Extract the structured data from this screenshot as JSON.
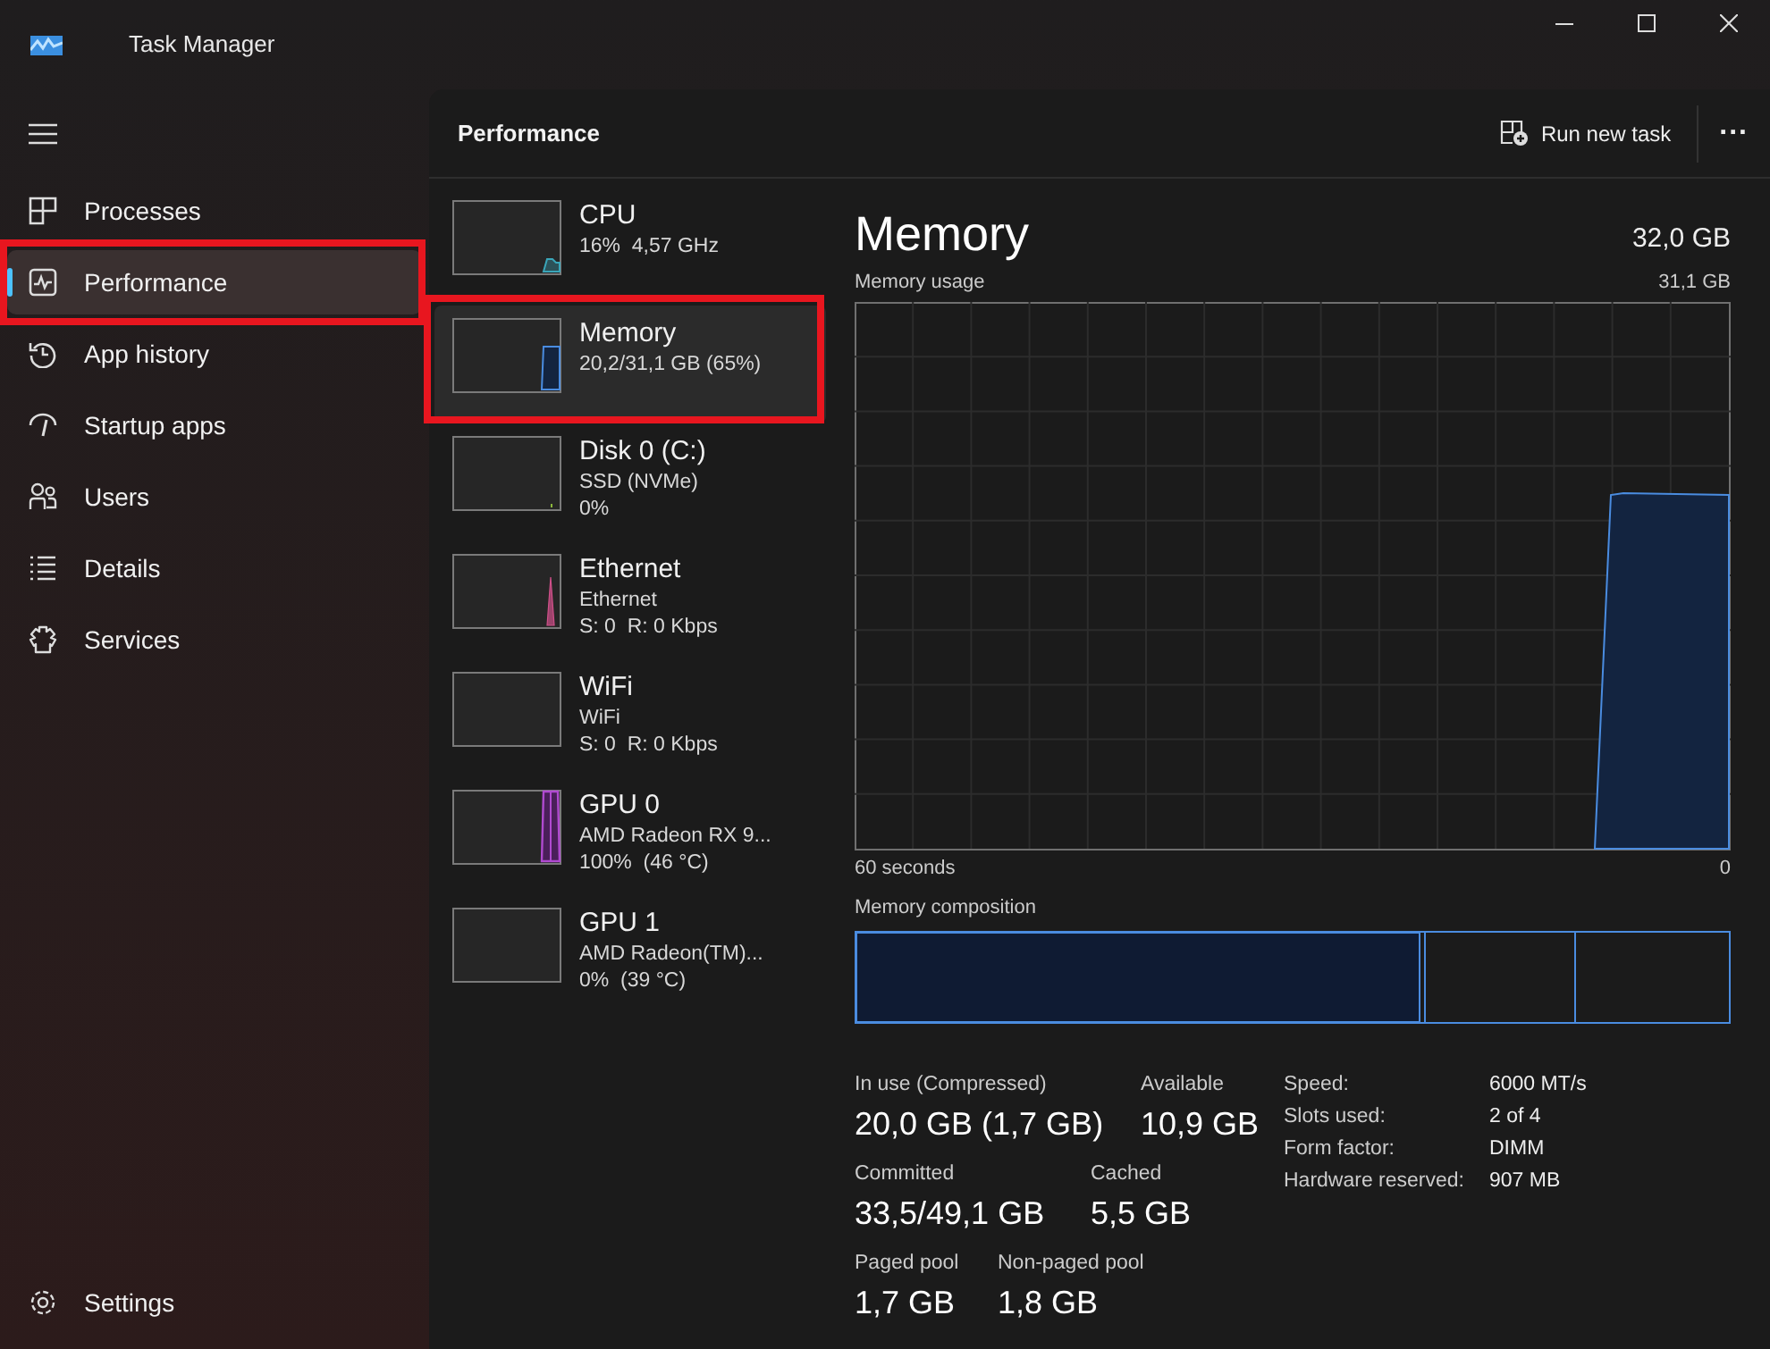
{
  "window": {
    "title": "Task Manager"
  },
  "nav": [
    {
      "label": "Processes",
      "selected": false,
      "annotated": false
    },
    {
      "label": "Performance",
      "selected": true,
      "annotated": true
    },
    {
      "label": "App history",
      "selected": false,
      "annotated": false
    },
    {
      "label": "Startup apps",
      "selected": false,
      "annotated": false
    },
    {
      "label": "Users",
      "selected": false,
      "annotated": false
    },
    {
      "label": "Details",
      "selected": false,
      "annotated": false
    },
    {
      "label": "Services",
      "selected": false,
      "annotated": false
    }
  ],
  "settings": {
    "label": "Settings"
  },
  "header": {
    "title": "Performance",
    "run_new_task": "Run new task",
    "more": "..."
  },
  "devices": [
    {
      "name": "CPU",
      "lines": [
        "16%  4,57 GHz"
      ],
      "selected": false,
      "annotated": false
    },
    {
      "name": "Memory",
      "lines": [
        "20,2/31,1 GB (65%)"
      ],
      "selected": true,
      "annotated": true
    },
    {
      "name": "Disk 0 (C:)",
      "lines": [
        "SSD (NVMe)",
        "0%"
      ],
      "selected": false,
      "annotated": false
    },
    {
      "name": "Ethernet",
      "lines": [
        "Ethernet",
        "S: 0  R: 0 Kbps"
      ],
      "selected": false,
      "annotated": false
    },
    {
      "name": "WiFi",
      "lines": [
        "WiFi",
        "S: 0  R: 0 Kbps"
      ],
      "selected": false,
      "annotated": false
    },
    {
      "name": "GPU 0",
      "lines": [
        "AMD Radeon RX 9...",
        "100%  (46 °C)"
      ],
      "selected": false,
      "annotated": false
    },
    {
      "name": "GPU 1",
      "lines": [
        "AMD Radeon(TM)...",
        "0%  (39 °C)"
      ],
      "selected": false,
      "annotated": false
    }
  ],
  "detail": {
    "title": "Memory",
    "total": "32,0 GB",
    "usage_label": "Memory usage",
    "usage_max": "31,1 GB",
    "x_start": "60 seconds",
    "x_end": "0",
    "composition_label": "Memory composition",
    "stats": [
      {
        "label": "In use (Compressed)",
        "value": "20,0 GB (1,7 GB)"
      },
      {
        "label": "Available",
        "value": "10,9 GB"
      },
      {
        "label": "Committed",
        "value": "33,5/49,1 GB"
      },
      {
        "label": "Cached",
        "value": "5,5 GB"
      },
      {
        "label": "Paged pool",
        "value": "1,7 GB"
      },
      {
        "label": "Non-paged pool",
        "value": "1,8 GB"
      }
    ],
    "properties": [
      {
        "label": "Speed:",
        "value": "6000 MT/s"
      },
      {
        "label": "Slots used:",
        "value": "2 of 4"
      },
      {
        "label": "Form factor:",
        "value": "DIMM"
      },
      {
        "label": "Hardware reserved:",
        "value": "907 MB"
      }
    ]
  }
}
